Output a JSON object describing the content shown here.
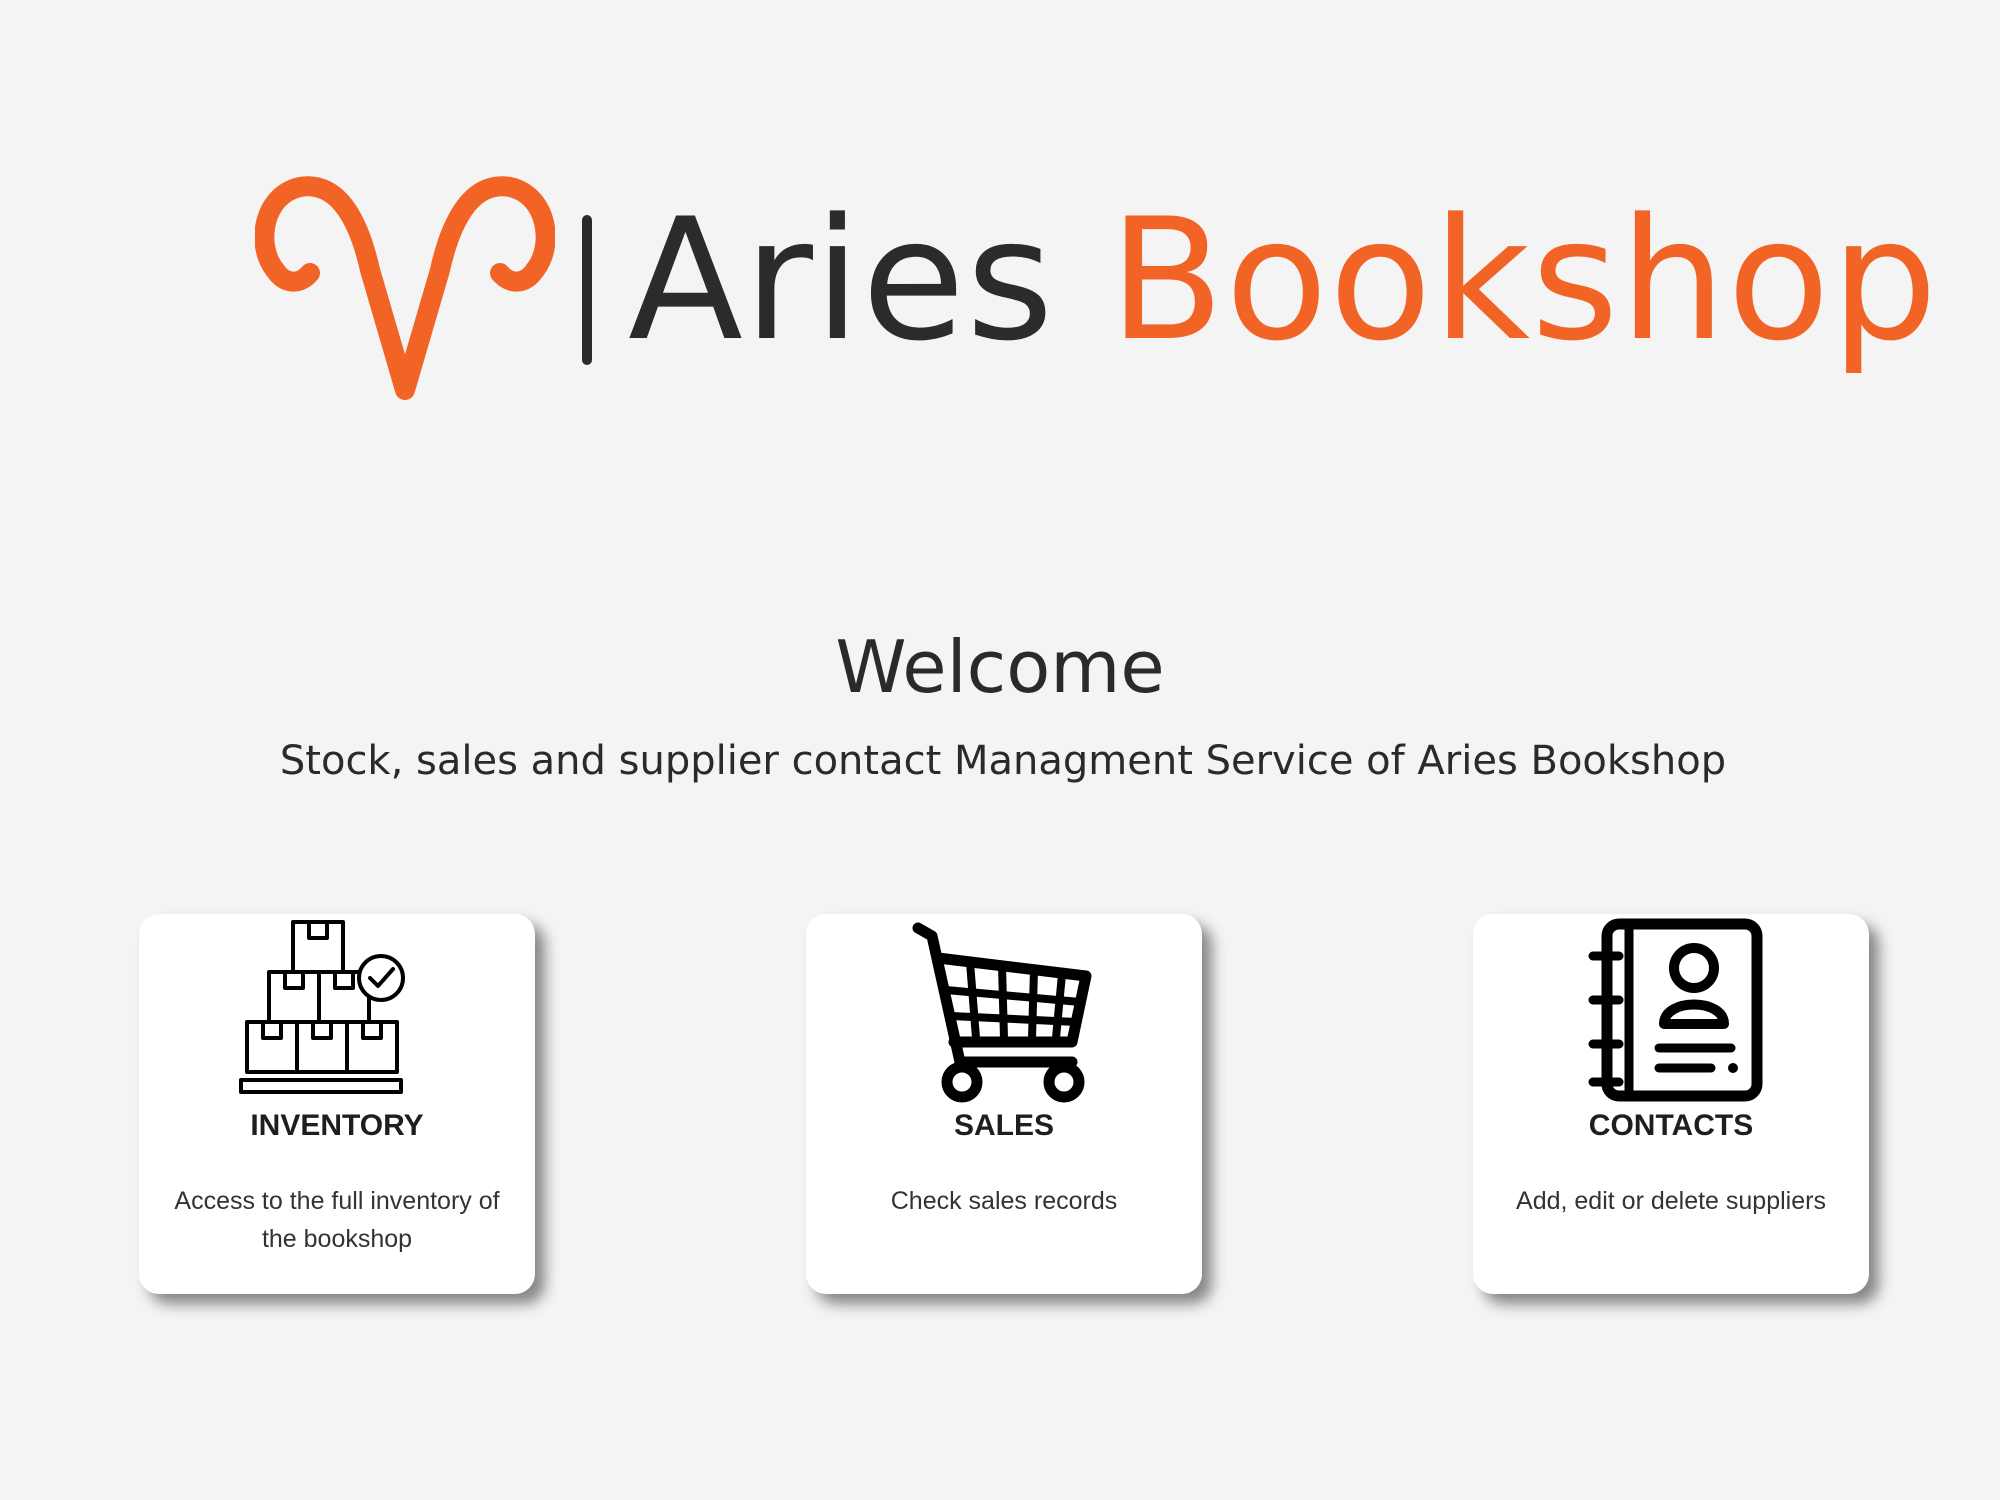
{
  "brand": {
    "name_part_1": "Aries",
    "name_part_2": "Bookshop",
    "primary_color": "#f26425",
    "dark_color": "#2b2b2b",
    "logo_icon": "aries-symbol-icon"
  },
  "welcome": {
    "title": "Welcome",
    "subtitle": "Stock, sales and supplier contact Managment Service of Aries Bookshop"
  },
  "cards": [
    {
      "title": "INVENTORY",
      "description": "Access to the full inventory of the bookshop",
      "icon": "inventory-boxes-icon"
    },
    {
      "title": "SALES",
      "description": "Check sales records",
      "icon": "shopping-cart-icon"
    },
    {
      "title": "CONTACTS",
      "description": "Add, edit or delete suppliers",
      "icon": "address-book-icon"
    }
  ],
  "colors": {
    "background": "#f4f4f4",
    "card_background": "#ffffff",
    "text": "#2a2a2a"
  }
}
